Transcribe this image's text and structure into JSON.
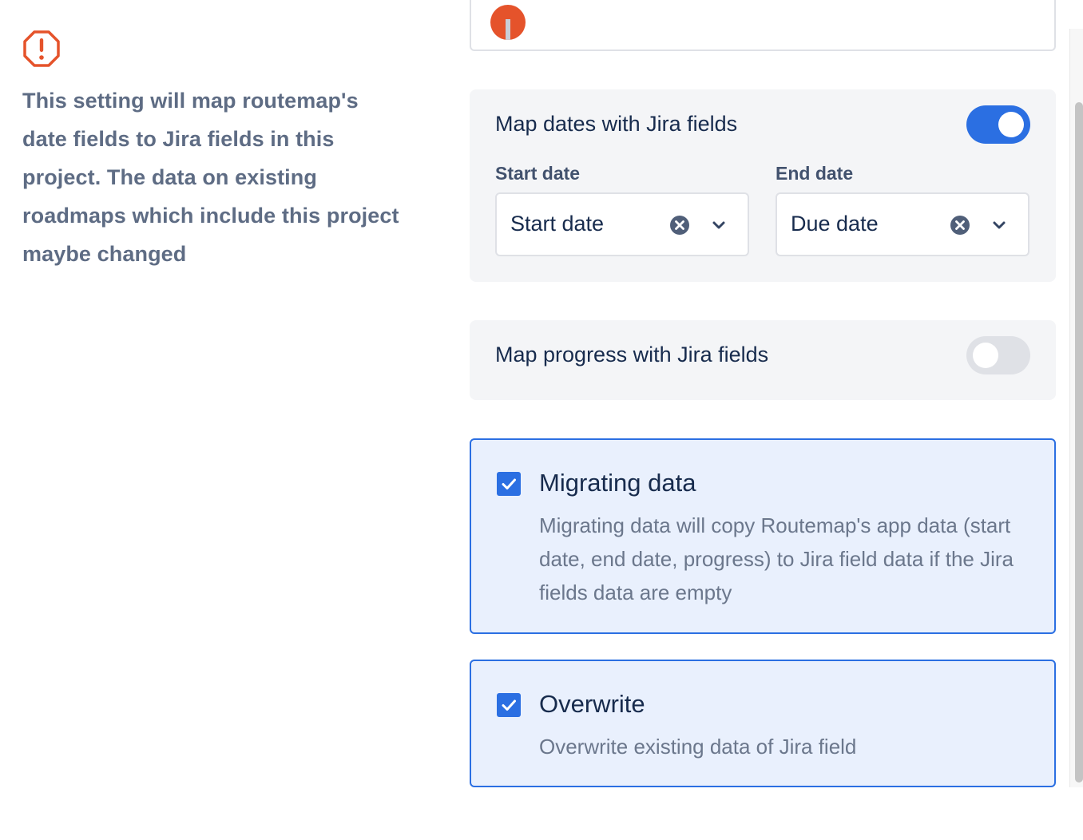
{
  "info": {
    "icon": "warning-octagon-icon",
    "icon_color": "#e5532b",
    "text": "This setting will map routemap's date fields to Jira fields in this project. The data on existing roadmaps which include this project maybe changed"
  },
  "top_card": {
    "text": ""
  },
  "map_dates": {
    "label": "Map dates with Jira fields",
    "enabled": true,
    "start": {
      "label": "Start date",
      "value": "Start date"
    },
    "end": {
      "label": "End date",
      "value": "Due date"
    }
  },
  "map_progress": {
    "label": "Map progress with Jira fields",
    "enabled": false
  },
  "migrate": {
    "checked": true,
    "title": "Migrating data",
    "description": "Migrating data will copy Routemap's app data (start date, end date, progress) to Jira field data if the Jira fields data are empty"
  },
  "overwrite": {
    "checked": true,
    "title": "Overwrite",
    "description": "Overwrite existing data of Jira field"
  },
  "colors": {
    "accent": "#2b6fe2",
    "panel_bg": "#f4f5f7",
    "card_bg": "#e9f0fd",
    "muted_text": "#5e6c84"
  }
}
